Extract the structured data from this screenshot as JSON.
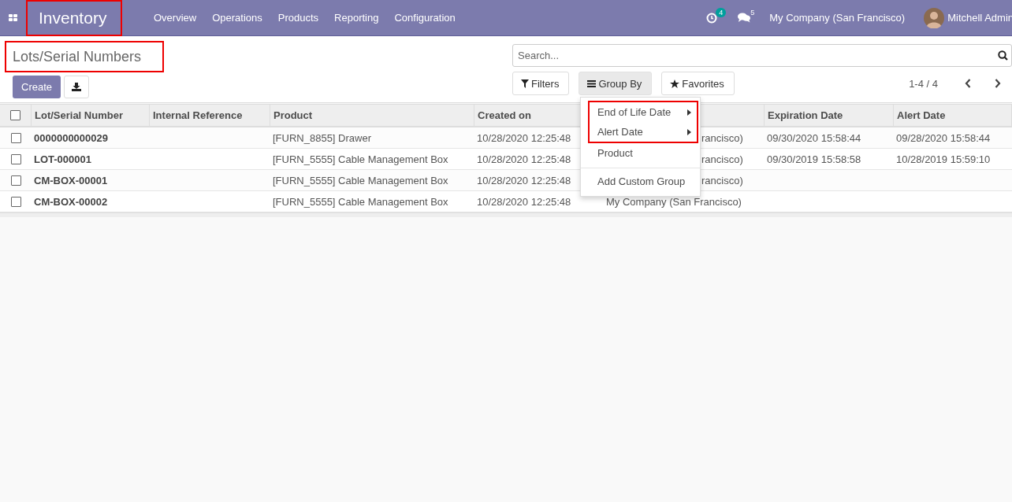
{
  "navbar": {
    "app_name": "Inventory",
    "app_name_highlighted": true,
    "menu": [
      "Overview",
      "Operations",
      "Products",
      "Reporting",
      "Configuration"
    ],
    "activity_count": "4",
    "message_count": "5",
    "company": "My Company (San Francisco)",
    "user": "Mitchell Admin"
  },
  "page": {
    "title": "Lots/Serial Numbers",
    "title_highlighted": true,
    "create_label": "Create",
    "search_placeholder": "Search...",
    "filters_label": "Filters",
    "group_by_label": "Group By",
    "group_by_open": true,
    "favorites_label": "Favorites",
    "pager": "1-4 / 4"
  },
  "group_by_menu": [
    {
      "label": "End of Life Date",
      "submenu": true,
      "highlighted": true
    },
    {
      "label": "Alert Date",
      "submenu": true,
      "highlighted": true
    },
    {
      "label": "Product",
      "submenu": false,
      "highlighted": false
    },
    {
      "label": "Add Custom Group",
      "submenu": false,
      "highlighted": false,
      "divider_before": true
    }
  ],
  "table": {
    "select_all_checked": false,
    "columns": [
      "Lot/Serial Number",
      "Internal Reference",
      "Product",
      "Created on",
      "",
      "Expiration Date",
      "Alert Date"
    ],
    "rows": [
      {
        "lot": "0000000000029",
        "internal_ref": "",
        "product": "[FURN_8855] Drawer",
        "created": "10/28/2020 12:25:48",
        "company": "rancisco)",
        "company_covered": true,
        "expiration": "09/30/2020 15:58:44",
        "alert": "09/28/2020 15:58:44",
        "checked": false
      },
      {
        "lot": "LOT-000001",
        "internal_ref": "",
        "product": "[FURN_5555] Cable Management Box",
        "created": "10/28/2020 12:25:48",
        "company": "rancisco)",
        "company_covered": true,
        "expiration": "09/30/2019 15:58:58",
        "alert": "10/28/2019 15:59:10",
        "checked": false
      },
      {
        "lot": "CM-BOX-00001",
        "internal_ref": "",
        "product": "[FURN_5555] Cable Management Box",
        "created": "10/28/2020 12:25:48",
        "company": "rancisco)",
        "company_covered": true,
        "expiration": "",
        "alert": "",
        "checked": false
      },
      {
        "lot": "CM-BOX-00002",
        "internal_ref": "",
        "product": "[FURN_5555] Cable Management Box",
        "created": "10/28/2020 12:25:48",
        "company": "My Company (San Francisco)",
        "company_covered": false,
        "expiration": "",
        "alert": "",
        "checked": false
      }
    ]
  }
}
